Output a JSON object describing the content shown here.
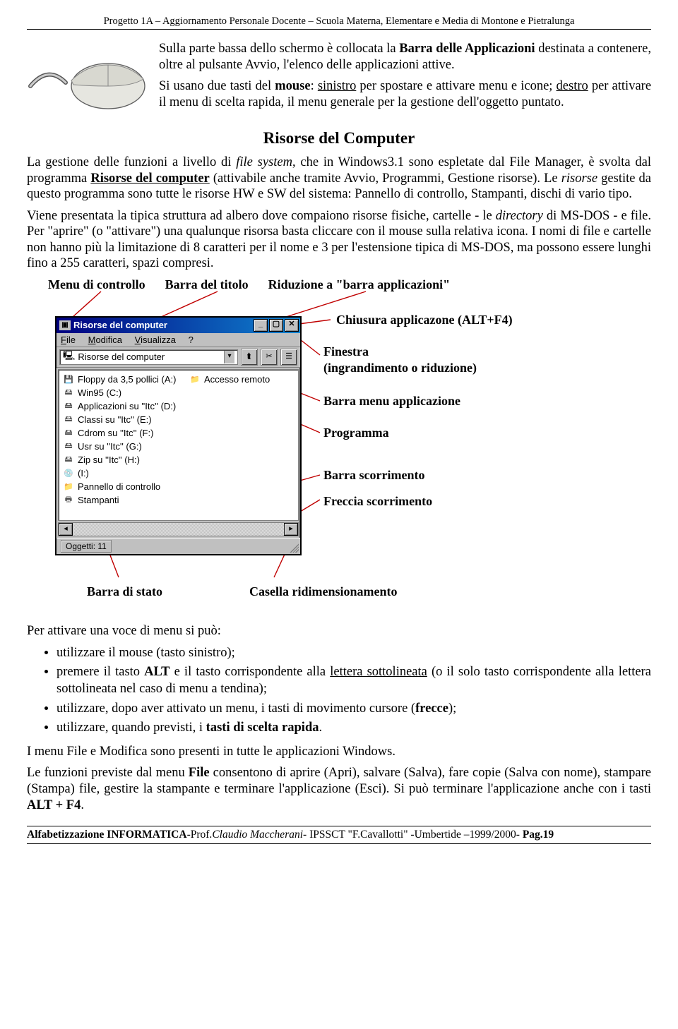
{
  "header": "Progetto 1A – Aggiornamento Personale Docente – Scuola Materna, Elementare e Media di Montone e Pietralunga",
  "intro": {
    "p1_a": "Sulla parte bassa dello schermo è collocata la ",
    "p1_b": "Barra delle Applicazioni",
    "p1_c": " destinata a contenere, oltre al pulsante Avvio, l'elenco delle applicazioni attive.",
    "p2_a": "Si usano due tasti del ",
    "p2_b": "mouse",
    "p2_c": ": ",
    "p2_d": "sinistro",
    "p2_e": " per spostare e attivare menu e icone; ",
    "p2_f": "destro",
    "p2_g": " per attivare il menu di scelta rapida, il menu generale per la gestione dell'oggetto puntato."
  },
  "section_title": "Risorse del Computer",
  "body": {
    "p1_a": "La gestione delle funzioni a livello di ",
    "p1_b": "file system",
    "p1_c": ", che in Windows3.1 sono espletate dal File Manager, è svolta dal programma ",
    "p1_d": "Risorse del computer",
    "p1_e": " (attivabile anche tramite Avvio, Programmi, Gestione risorse). Le ",
    "p1_f": "risorse",
    "p1_g": " gestite da questo programma sono tutte le risorse HW e SW del sistema: Pannello di controllo, Stampanti, dischi di vario tipo.",
    "p2_a": "Viene presentata la tipica struttura ad albero dove compaiono risorse fisiche, cartelle - le ",
    "p2_b": "directory",
    "p2_c": " di MS-DOS - e file. Per \"aprire\" (o \"attivare\") una qualunque risorsa basta cliccare con il mouse sulla relativa icona. I nomi di file e cartelle non hanno più la limitazione di 8 caratteri per il nome e 3 per l'estensione tipica di MS-DOS, ma possono essere lunghi fino a 255 caratteri, spazi compresi."
  },
  "diagram_labels": {
    "menu_controllo": "Menu di controllo",
    "barra_titolo": "Barra del titolo",
    "riduzione": "Riduzione a \"barra applicazioni\"",
    "chiusura": "Chiusura applicazone (ALT+F4)",
    "finestra1": "Finestra",
    "finestra2": "(ingrandimento o riduzione)",
    "barra_menu_app": "Barra menu applicazione",
    "programma": "Programma",
    "barra_scorr": "Barra scorrimento",
    "freccia_scorr": "Freccia scorrimento",
    "barra_stato": "Barra di stato",
    "casella_redim": "Casella ridimensionamento"
  },
  "win95": {
    "title": "Risorse del computer",
    "menu": {
      "file": "File",
      "modifica": "Modifica",
      "visualizza": "Visualizza",
      "help": "?"
    },
    "address": "Risorse del computer",
    "items": [
      "Floppy da 3,5 pollici (A:)",
      "Win95 (C:)",
      "Applicazioni su ''Itc'' (D:)",
      "Classi su ''Itc'' (E:)",
      "Cdrom su ''Itc'' (F:)",
      "Usr su ''Itc'' (G:)",
      "Zip su ''Itc'' (H:)",
      "(I:)",
      "Pannello di controllo",
      "Stampanti"
    ],
    "remote_item": "Accesso remoto",
    "status": "Oggetti: 11"
  },
  "after_diagram": {
    "p1": "Per attivare una voce di menu si può:",
    "bullets": {
      "b1": "utilizzare il mouse (tasto sinistro);",
      "b2_a": "premere il tasto ",
      "b2_b": "ALT",
      "b2_c": " e il tasto corrispondente alla ",
      "b2_d": "lettera sottolineata",
      "b2_e": " (o il solo tasto corrispondente alla lettera sottolineata nel caso di menu a tendina);",
      "b3_a": "utilizzare, dopo aver attivato un menu, i tasti di movimento cursore (",
      "b3_b": "frecce",
      "b3_c": ");",
      "b4_a": "utilizzare, quando previsti, i ",
      "b4_b": "tasti di scelta rapida",
      "b4_c": "."
    },
    "p2": "I menu File e Modifica sono presenti in tutte le applicazioni Windows.",
    "p3_a": "Le funzioni previste dal menu ",
    "p3_b": "File",
    "p3_c": " consentono di aprire (Apri), salvare (Salva), fare copie (Salva con nome), stampare (Stampa) file, gestire la stampante e terminare l'applicazione (Esci). Si può terminare l'applicazione anche con i tasti ",
    "p3_d": "ALT + F4",
    "p3_e": "."
  },
  "footer": {
    "left_a": "Alfabetizzazione INFORMATICA",
    "left_b": "-Prof.",
    "left_c": "Claudio Maccherani",
    "left_d": "- IPSSCT \"F.Cavallotti\" -Umbertide –1999/2000- ",
    "right_a": "Pag.",
    "right_b": "19"
  }
}
